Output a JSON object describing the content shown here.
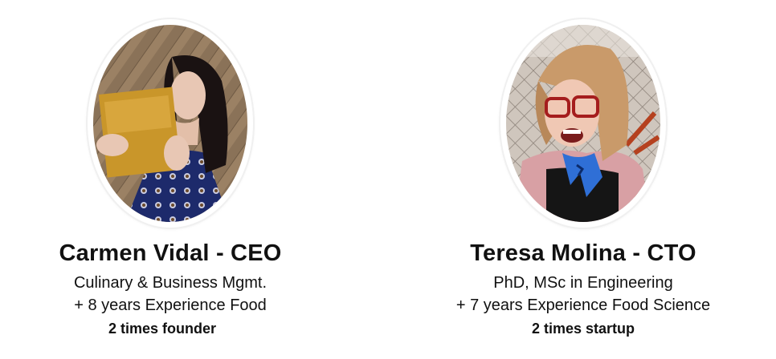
{
  "people": [
    {
      "name": "Carmen Vidal - CEO",
      "line1": "Culinary & Business Mgmt.",
      "line2": "+ 8 years Experience Food",
      "line3": "2 times founder"
    },
    {
      "name": "Teresa Molina - CTO",
      "line1": "PhD, MSc in Engineering",
      "line2": "+ 7 years Experience Food Science",
      "line3": "2 times startup"
    }
  ]
}
